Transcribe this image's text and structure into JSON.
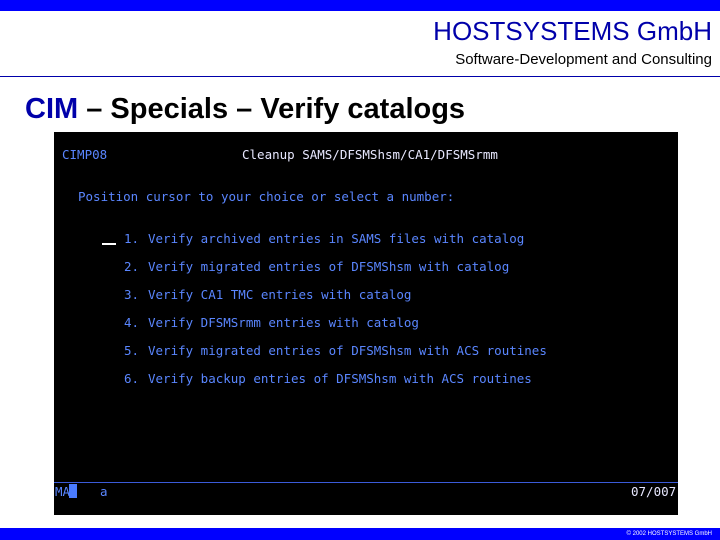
{
  "header": {
    "company": "HOSTSYSTEMS GmbH",
    "subtitle": "Software-Development and Consulting"
  },
  "slide": {
    "title_cim": "CIM",
    "title_rest": " – Specials – Verify catalogs"
  },
  "terminal": {
    "panel_id": "CIMP08",
    "panel_title": "Cleanup SAMS/DFSMShsm/CA1/DFSMSrmm",
    "prompt": "Position cursor to your choice or select a number:",
    "options": [
      {
        "number": "1.",
        "label": "Verify archived entries in SAMS files with catalog"
      },
      {
        "number": "2.",
        "label": "Verify migrated entries of DFSMShsm with catalog"
      },
      {
        "number": "3.",
        "label": "Verify CA1 TMC entries with catalog"
      },
      {
        "number": "4.",
        "label": "Verify DFSMSrmm entries with catalog"
      },
      {
        "number": "5.",
        "label": "Verify migrated entries of DFSMShsm with ACS routines"
      },
      {
        "number": "6.",
        "label": "Verify backup entries of DFSMShsm with ACS routines"
      }
    ],
    "status_left": "MA",
    "status_session": "a",
    "status_position": "07/007"
  },
  "footer": {
    "copyright": "© 2002 HOSTSYSTEMS GmbH"
  },
  "colors": {
    "brand_blue": "#0000aa",
    "bar_blue": "#0000ff",
    "terminal_bg": "#000000",
    "terminal_text": "#5a86ff",
    "terminal_highlight": "#e8e8ff"
  }
}
